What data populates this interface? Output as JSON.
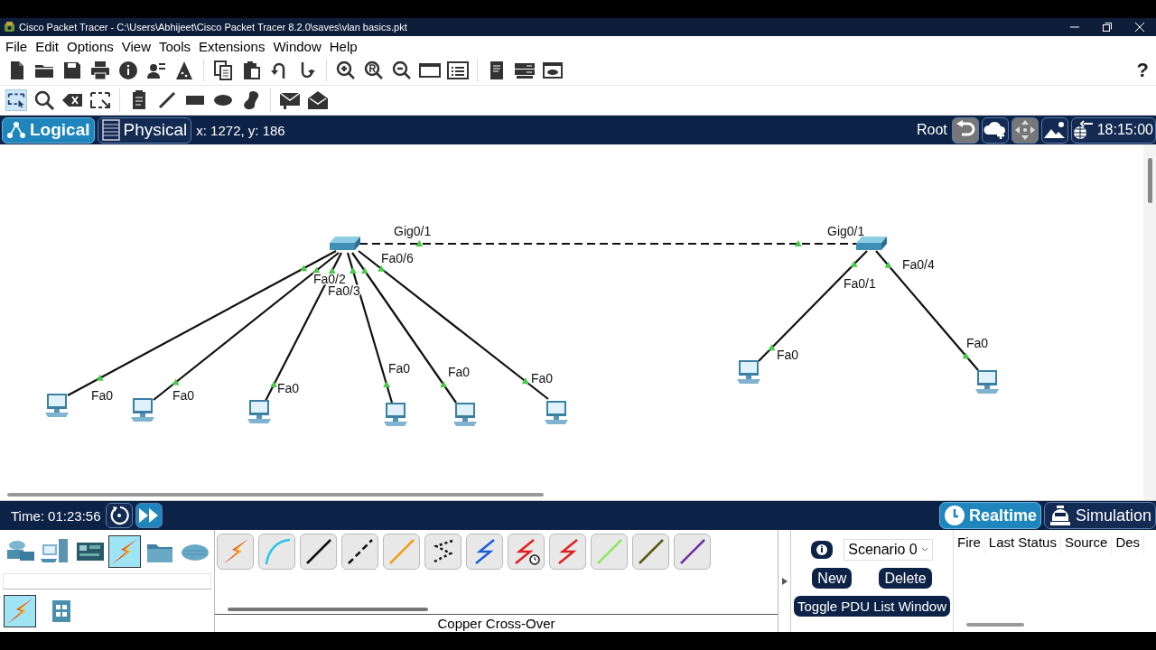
{
  "window": {
    "title": "Cisco Packet Tracer - C:\\Users\\Abhijeet\\Cisco Packet Tracer 8.2.0\\saves\\vlan basics.pkt"
  },
  "menu": [
    "File",
    "Edit",
    "Options",
    "View",
    "Tools",
    "Extensions",
    "Window",
    "Help"
  ],
  "help": "?",
  "workspace_bar": {
    "tabs": [
      {
        "label": "Logical",
        "selected": true
      },
      {
        "label": "Physical",
        "selected": false
      }
    ],
    "coordinates": "x: 1272, y: 186",
    "root": "Root",
    "clock": "18:15:00"
  },
  "canvas": {
    "trunk": {
      "kind": "cross-over",
      "ends": [
        "Gig0/1",
        "Gig0/1"
      ]
    },
    "switches": [
      {
        "kind": "switch",
        "hosts": [
          {
            "kind": "pc",
            "link": {
              "kind": "straight"
            },
            "port": "Fa0"
          },
          {
            "kind": "pc",
            "link": {
              "kind": "straight"
            },
            "port": "Fa0",
            "switch_port": "Fa0/2"
          },
          {
            "kind": "pc",
            "link": {
              "kind": "straight"
            },
            "port": "Fa0",
            "switch_port": "Fa0/3"
          },
          {
            "kind": "pc",
            "link": {
              "kind": "straight"
            },
            "port": "Fa0"
          },
          {
            "kind": "pc",
            "link": {
              "kind": "straight"
            },
            "port": "Fa0"
          },
          {
            "kind": "pc",
            "link": {
              "kind": "straight"
            },
            "port": "Fa0",
            "switch_port": "Fa0/6"
          }
        ]
      },
      {
        "kind": "switch",
        "hosts": [
          {
            "kind": "pc",
            "link": {
              "kind": "straight"
            },
            "port": "Fa0",
            "switch_port": "Fa0/1"
          },
          {
            "kind": "pc",
            "link": {
              "kind": "straight"
            },
            "port": "Fa0",
            "switch_port": "Fa0/4"
          }
        ]
      }
    ]
  },
  "time_bar": {
    "time": "Time: 01:23:56",
    "modes": [
      {
        "label": "Realtime",
        "selected": true
      },
      {
        "label": "Simulation",
        "selected": false
      }
    ]
  },
  "device_categories": [
    {
      "kind": "network",
      "selected": false
    },
    {
      "kind": "end",
      "selected": false
    },
    {
      "kind": "component",
      "selected": false
    },
    {
      "kind": "connections",
      "selected": true
    },
    {
      "kind": "folder",
      "selected": false
    },
    {
      "kind": "cloud",
      "selected": false
    }
  ],
  "subcategories": [
    {
      "kind": "connections",
      "selected": true
    },
    {
      "kind": "grid",
      "selected": false
    }
  ],
  "cables": [
    {
      "kind": "auto"
    },
    {
      "kind": "console"
    },
    {
      "kind": "straight"
    },
    {
      "kind": "cross"
    },
    {
      "kind": "fiber"
    },
    {
      "kind": "phone"
    },
    {
      "kind": "coax"
    },
    {
      "kind": "serial-dce"
    },
    {
      "kind": "serial-dte"
    },
    {
      "kind": "octal"
    },
    {
      "kind": "iot"
    },
    {
      "kind": "usb"
    }
  ],
  "cable_caption": "Copper Cross-Over",
  "scenario": {
    "name": "Scenario 0",
    "buttons": [
      "New",
      "Delete"
    ],
    "toggle": "Toggle PDU List Window"
  },
  "pdu_table": {
    "columns": [
      "Fire",
      "Last Status",
      "Source",
      "Des"
    ]
  }
}
